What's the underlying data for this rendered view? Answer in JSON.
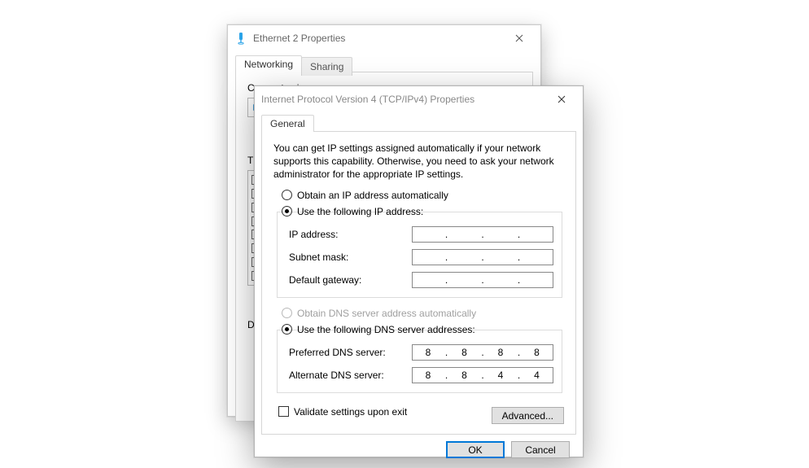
{
  "back_window": {
    "title": "Ethernet 2 Properties",
    "tabs": {
      "networking": "Networking",
      "sharing": "Sharing"
    },
    "connect_label": "Connect using:",
    "items_label": "This connection uses the following items:",
    "desc_label": "Description"
  },
  "front_window": {
    "title": "Internet Protocol Version 4 (TCP/IPv4) Properties",
    "tab_general": "General",
    "info": "You can get IP settings assigned automatically if your network supports this capability. Otherwise, you need to ask your network administrator for the appropriate IP settings.",
    "ip": {
      "radio_auto": "Obtain an IP address automatically",
      "radio_manual": "Use the following IP address:",
      "ip_label": "IP address:",
      "subnet_label": "Subnet mask:",
      "gateway_label": "Default gateway:",
      "ip_value": [
        "",
        "",
        "",
        ""
      ],
      "subnet_value": [
        "",
        "",
        "",
        ""
      ],
      "gateway_value": [
        "",
        "",
        "",
        ""
      ]
    },
    "dns": {
      "radio_auto": "Obtain DNS server address automatically",
      "radio_manual": "Use the following DNS server addresses:",
      "preferred_label": "Preferred DNS server:",
      "alternate_label": "Alternate DNS server:",
      "preferred_value": [
        "8",
        "8",
        "8",
        "8"
      ],
      "alternate_value": [
        "8",
        "8",
        "4",
        "4"
      ]
    },
    "validate_label": "Validate settings upon exit",
    "advanced_label": "Advanced...",
    "ok_label": "OK",
    "cancel_label": "Cancel"
  }
}
